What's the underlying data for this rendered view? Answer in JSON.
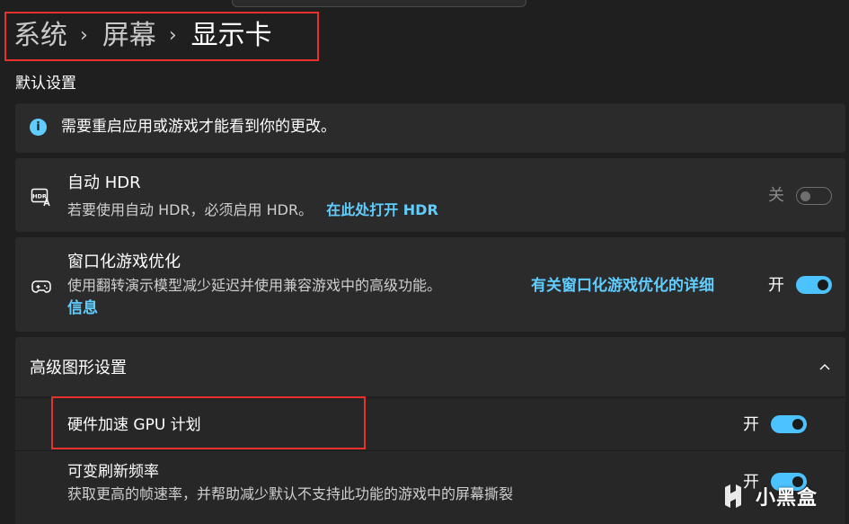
{
  "breadcrumb": {
    "items": [
      "系统",
      "屏幕",
      "显示卡"
    ],
    "separator": "›"
  },
  "default_settings": {
    "heading": "默认设置",
    "notice": "需要重启应用或游戏才能看到你的更改。"
  },
  "auto_hdr": {
    "title": "自动 HDR",
    "description": "若要使用自动 HDR，必须启用 HDR。",
    "link": "在此处打开 HDR",
    "state_label": "关",
    "enabled": false
  },
  "windowed_optimization": {
    "title": "窗口化游戏优化",
    "description": "使用翻转演示模型减少延迟并使用兼容游戏中的高级功能。",
    "link_line1": "有关窗口化游戏优化的详细",
    "link_line2": "信息",
    "state_label": "开",
    "enabled": true
  },
  "advanced_graphics": {
    "title": "高级图形设置",
    "expanded": true,
    "items": [
      {
        "title": "硬件加速 GPU 计划",
        "state_label": "开",
        "enabled": true
      },
      {
        "title": "可变刷新频率",
        "description": "获取更高的帧速率，并帮助减少默认不支持此功能的游戏中的屏幕撕裂",
        "state_label": "开",
        "enabled": true
      }
    ]
  },
  "watermark": "小黑盒",
  "colors": {
    "accent": "#4cc2ff",
    "link": "#60cdff",
    "highlight_box": "#e5322d",
    "background": "#1f1f1f",
    "card": "#2b2b2b"
  }
}
